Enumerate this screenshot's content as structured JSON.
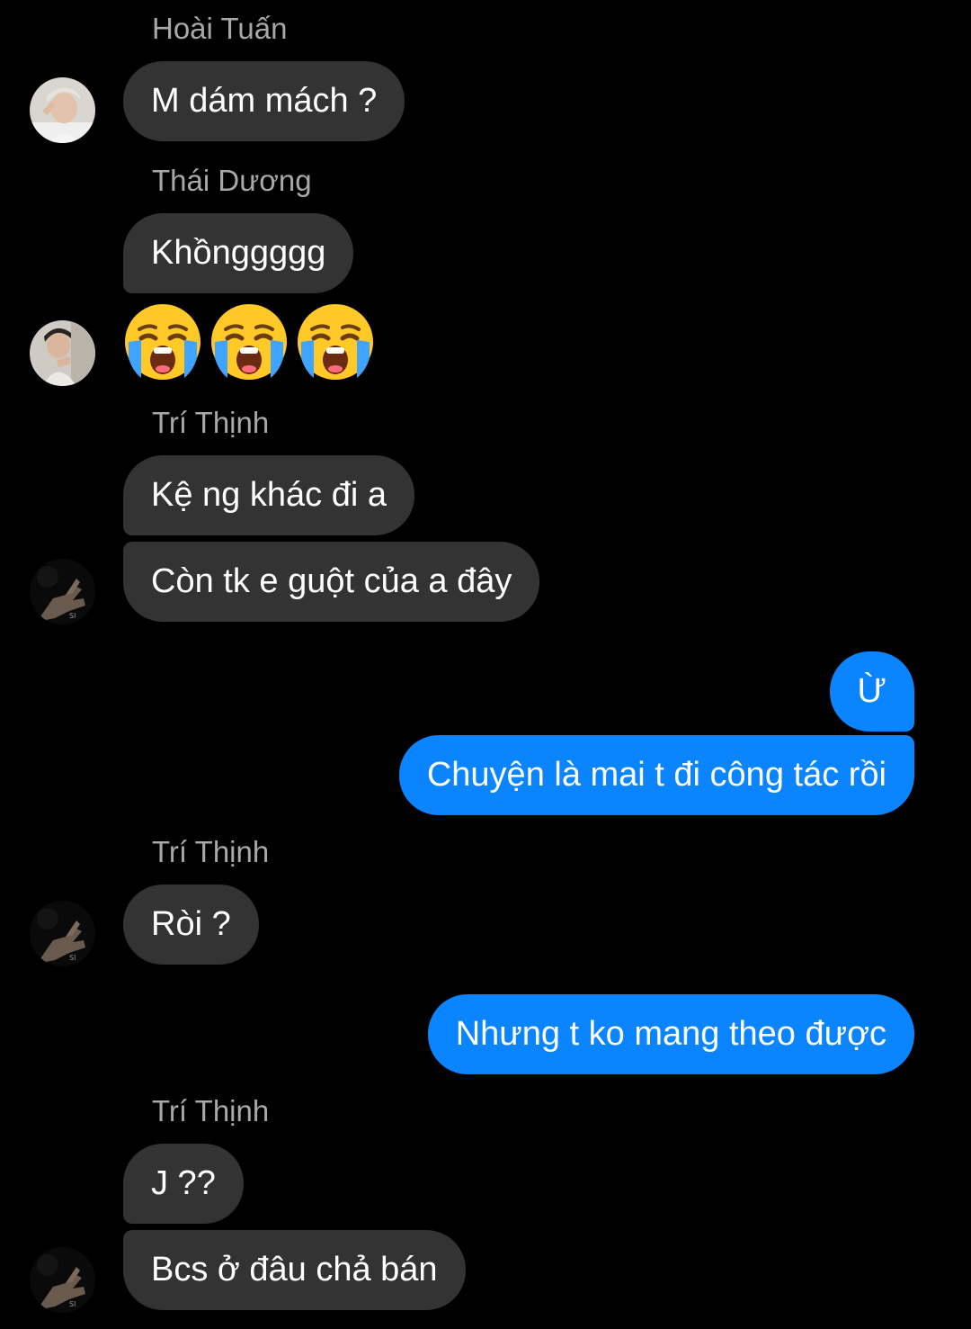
{
  "thread": {
    "messages": [
      {
        "type": "name",
        "text": "Hoài Tuấn"
      },
      {
        "type": "incoming",
        "text": "M dám mách ?"
      },
      {
        "type": "name",
        "text": "Thái Dương"
      },
      {
        "type": "incoming",
        "text": "Khồnggggg"
      },
      {
        "type": "emoji",
        "icon": "loudly-crying-face-icon",
        "count": 3
      },
      {
        "type": "name",
        "text": "Trí Thịnh"
      },
      {
        "type": "incoming",
        "text": "Kệ ng khác đi a"
      },
      {
        "type": "incoming",
        "text": "Còn tk e guột của a đây"
      },
      {
        "type": "outgoing",
        "text": "Ừ"
      },
      {
        "type": "outgoing",
        "text": "Chuyện là mai t đi công tác rồi"
      },
      {
        "type": "name",
        "text": "Trí Thịnh"
      },
      {
        "type": "incoming",
        "text": "Ròi ?"
      },
      {
        "type": "outgoing",
        "text": "Nhưng t ko mang theo được"
      },
      {
        "type": "name",
        "text": "Trí Thịnh"
      },
      {
        "type": "incoming",
        "text": "J ??"
      },
      {
        "type": "incoming",
        "text": "Bcs ở đâu chả bán"
      }
    ]
  },
  "colors": {
    "background": "#000000",
    "incoming_bubble": "#333333",
    "outgoing_bubble": "#0a84ff",
    "sender_name": "#a8a8a8"
  }
}
